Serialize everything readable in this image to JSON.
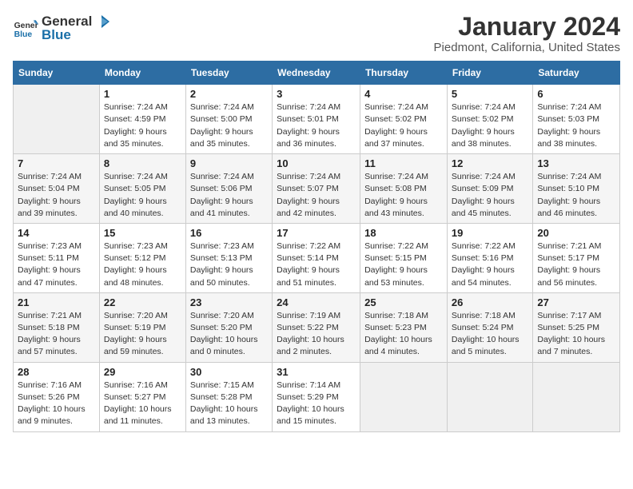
{
  "header": {
    "logo_line1": "General",
    "logo_line2": "Blue",
    "title": "January 2024",
    "subtitle": "Piedmont, California, United States"
  },
  "calendar": {
    "days_of_week": [
      "Sunday",
      "Monday",
      "Tuesday",
      "Wednesday",
      "Thursday",
      "Friday",
      "Saturday"
    ],
    "weeks": [
      [
        {
          "day": "",
          "info": ""
        },
        {
          "day": "1",
          "info": "Sunrise: 7:24 AM\nSunset: 4:59 PM\nDaylight: 9 hours\nand 35 minutes."
        },
        {
          "day": "2",
          "info": "Sunrise: 7:24 AM\nSunset: 5:00 PM\nDaylight: 9 hours\nand 35 minutes."
        },
        {
          "day": "3",
          "info": "Sunrise: 7:24 AM\nSunset: 5:01 PM\nDaylight: 9 hours\nand 36 minutes."
        },
        {
          "day": "4",
          "info": "Sunrise: 7:24 AM\nSunset: 5:02 PM\nDaylight: 9 hours\nand 37 minutes."
        },
        {
          "day": "5",
          "info": "Sunrise: 7:24 AM\nSunset: 5:02 PM\nDaylight: 9 hours\nand 38 minutes."
        },
        {
          "day": "6",
          "info": "Sunrise: 7:24 AM\nSunset: 5:03 PM\nDaylight: 9 hours\nand 38 minutes."
        }
      ],
      [
        {
          "day": "7",
          "info": "Sunrise: 7:24 AM\nSunset: 5:04 PM\nDaylight: 9 hours\nand 39 minutes."
        },
        {
          "day": "8",
          "info": "Sunrise: 7:24 AM\nSunset: 5:05 PM\nDaylight: 9 hours\nand 40 minutes."
        },
        {
          "day": "9",
          "info": "Sunrise: 7:24 AM\nSunset: 5:06 PM\nDaylight: 9 hours\nand 41 minutes."
        },
        {
          "day": "10",
          "info": "Sunrise: 7:24 AM\nSunset: 5:07 PM\nDaylight: 9 hours\nand 42 minutes."
        },
        {
          "day": "11",
          "info": "Sunrise: 7:24 AM\nSunset: 5:08 PM\nDaylight: 9 hours\nand 43 minutes."
        },
        {
          "day": "12",
          "info": "Sunrise: 7:24 AM\nSunset: 5:09 PM\nDaylight: 9 hours\nand 45 minutes."
        },
        {
          "day": "13",
          "info": "Sunrise: 7:24 AM\nSunset: 5:10 PM\nDaylight: 9 hours\nand 46 minutes."
        }
      ],
      [
        {
          "day": "14",
          "info": "Sunrise: 7:23 AM\nSunset: 5:11 PM\nDaylight: 9 hours\nand 47 minutes."
        },
        {
          "day": "15",
          "info": "Sunrise: 7:23 AM\nSunset: 5:12 PM\nDaylight: 9 hours\nand 48 minutes."
        },
        {
          "day": "16",
          "info": "Sunrise: 7:23 AM\nSunset: 5:13 PM\nDaylight: 9 hours\nand 50 minutes."
        },
        {
          "day": "17",
          "info": "Sunrise: 7:22 AM\nSunset: 5:14 PM\nDaylight: 9 hours\nand 51 minutes."
        },
        {
          "day": "18",
          "info": "Sunrise: 7:22 AM\nSunset: 5:15 PM\nDaylight: 9 hours\nand 53 minutes."
        },
        {
          "day": "19",
          "info": "Sunrise: 7:22 AM\nSunset: 5:16 PM\nDaylight: 9 hours\nand 54 minutes."
        },
        {
          "day": "20",
          "info": "Sunrise: 7:21 AM\nSunset: 5:17 PM\nDaylight: 9 hours\nand 56 minutes."
        }
      ],
      [
        {
          "day": "21",
          "info": "Sunrise: 7:21 AM\nSunset: 5:18 PM\nDaylight: 9 hours\nand 57 minutes."
        },
        {
          "day": "22",
          "info": "Sunrise: 7:20 AM\nSunset: 5:19 PM\nDaylight: 9 hours\nand 59 minutes."
        },
        {
          "day": "23",
          "info": "Sunrise: 7:20 AM\nSunset: 5:20 PM\nDaylight: 10 hours\nand 0 minutes."
        },
        {
          "day": "24",
          "info": "Sunrise: 7:19 AM\nSunset: 5:22 PM\nDaylight: 10 hours\nand 2 minutes."
        },
        {
          "day": "25",
          "info": "Sunrise: 7:18 AM\nSunset: 5:23 PM\nDaylight: 10 hours\nand 4 minutes."
        },
        {
          "day": "26",
          "info": "Sunrise: 7:18 AM\nSunset: 5:24 PM\nDaylight: 10 hours\nand 5 minutes."
        },
        {
          "day": "27",
          "info": "Sunrise: 7:17 AM\nSunset: 5:25 PM\nDaylight: 10 hours\nand 7 minutes."
        }
      ],
      [
        {
          "day": "28",
          "info": "Sunrise: 7:16 AM\nSunset: 5:26 PM\nDaylight: 10 hours\nand 9 minutes."
        },
        {
          "day": "29",
          "info": "Sunrise: 7:16 AM\nSunset: 5:27 PM\nDaylight: 10 hours\nand 11 minutes."
        },
        {
          "day": "30",
          "info": "Sunrise: 7:15 AM\nSunset: 5:28 PM\nDaylight: 10 hours\nand 13 minutes."
        },
        {
          "day": "31",
          "info": "Sunrise: 7:14 AM\nSunset: 5:29 PM\nDaylight: 10 hours\nand 15 minutes."
        },
        {
          "day": "",
          "info": ""
        },
        {
          "day": "",
          "info": ""
        },
        {
          "day": "",
          "info": ""
        }
      ]
    ]
  }
}
